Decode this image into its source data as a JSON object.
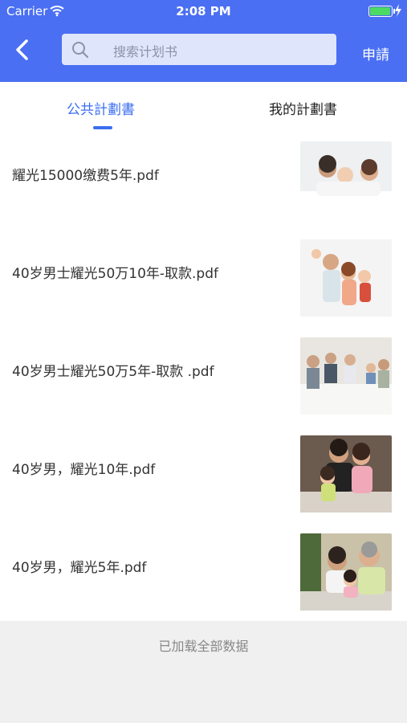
{
  "status_bar": {
    "carrier": "Carrier",
    "time": "2:08 PM"
  },
  "header": {
    "search_placeholder": "搜索计划书",
    "apply_label": "申請"
  },
  "tabs": [
    {
      "label": "公共計劃書",
      "active": true
    },
    {
      "label": "我的計劃書",
      "active": false
    }
  ],
  "items": [
    {
      "name": "耀光15000缴费5年.pdf",
      "thumbnail": "family-photo"
    },
    {
      "name": "40岁男士耀光50万10年-取款.pdf",
      "thumbnail": "family-photo"
    },
    {
      "name": "40岁男士耀光50万5年-取款 .pdf",
      "thumbnail": "family-photo"
    },
    {
      "name": "40岁男，耀光10年.pdf",
      "thumbnail": "family-photo"
    },
    {
      "name": "40岁男，耀光5年.pdf",
      "thumbnail": "family-photo"
    }
  ],
  "footer": {
    "message": "已加载全部数据"
  },
  "colors": {
    "brand": "#4a6ff2",
    "tab_active": "#3b6ef0"
  }
}
